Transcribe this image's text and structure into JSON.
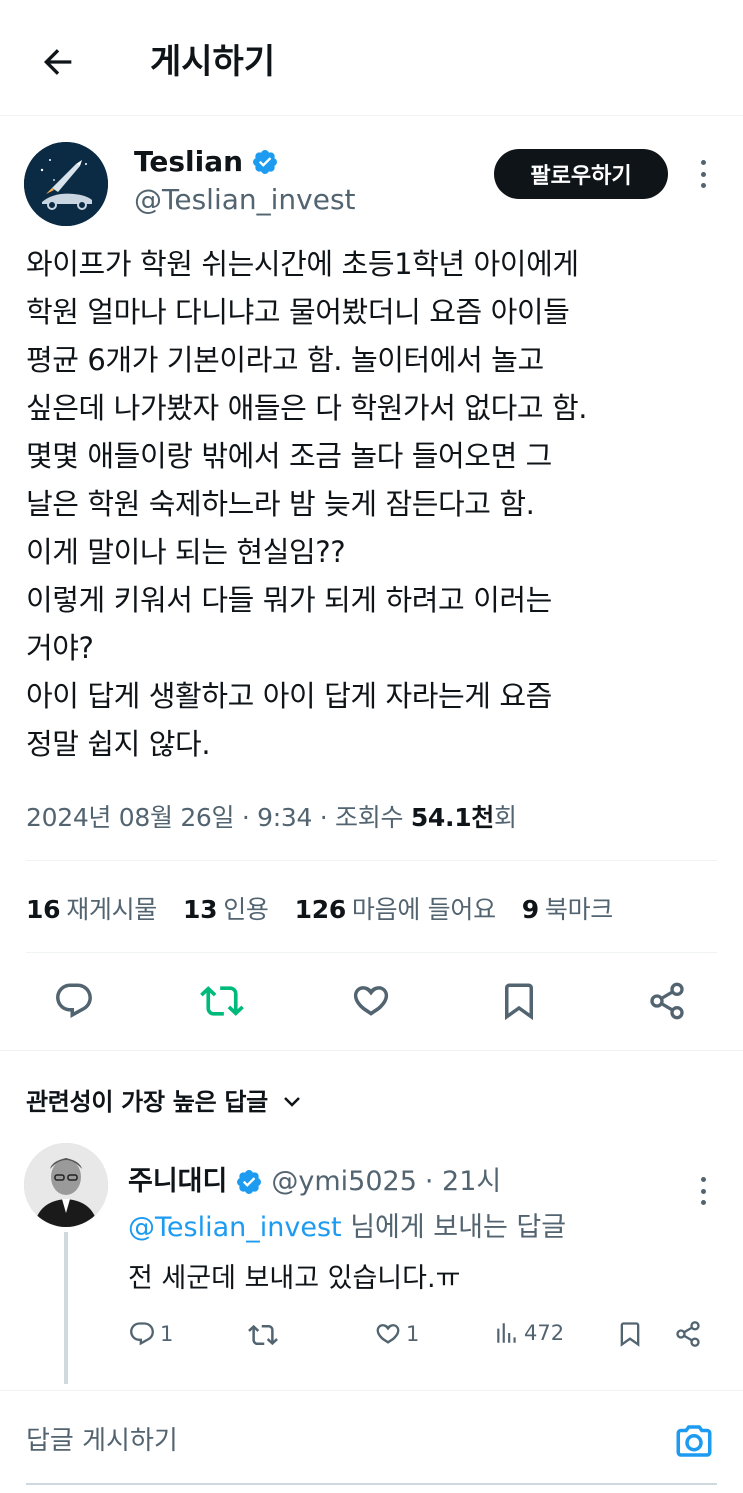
{
  "header": {
    "title": "게시하기",
    "back_icon": "arrow-left-icon"
  },
  "author": {
    "name": "Teslian",
    "handle": "@Teslian_invest",
    "verified": true,
    "follow_label": "팔로우하기"
  },
  "tweet": {
    "text": "와이프가 학원 쉬는시간에 초등1학년 아이에게\n학원 얼마나 다니냐고 물어봤더니 요즘 아이들\n평균 6개가 기본이라고 함. 놀이터에서 놀고\n싶은데 나가봤자 애들은 다 학원가서 없다고 함.\n몇몇 애들이랑 밖에서 조금 놀다 들어오면 그\n날은 학원 숙제하느라 밤 늦게 잠든다고 함.\n이게 말이나 되는 현실임??\n이렇게 키워서 다들 뭐가 되게 하려고 이러는\n거야?\n아이 답게 생활하고 아이 답게 자라는게 요즘\n정말 쉽지 않다.",
    "meta_prefix": "2024년 08월 26일 · 9:34 · 조회수 ",
    "views_number": "54.1천",
    "views_suffix": "회"
  },
  "stats": {
    "reposts_count": "16",
    "reposts_label": "재게시물",
    "quotes_count": "13",
    "quotes_label": "인용",
    "likes_count": "126",
    "likes_label": "마음에 들어요",
    "bookmarks_count": "9",
    "bookmarks_label": "북마크"
  },
  "colors": {
    "accent": "#1d9bf0",
    "repost_green": "#00ba7c",
    "muted": "#536471",
    "text": "#0f1419"
  },
  "sort": {
    "label": "관련성이 가장 높은 답글"
  },
  "reply": {
    "name": "주니대디",
    "verified": true,
    "handle": "@ymi5025",
    "time": "· 21시",
    "mention": "@Teslian_invest",
    "replying_suffix": " 님에게 보내는 답글",
    "text": "전 세군데 보내고 있습니다.ㅠ",
    "comments": "1",
    "reposts": "",
    "likes": "1",
    "views": "472"
  },
  "composer": {
    "placeholder": "답글 게시하기",
    "camera_icon": "camera-icon"
  }
}
